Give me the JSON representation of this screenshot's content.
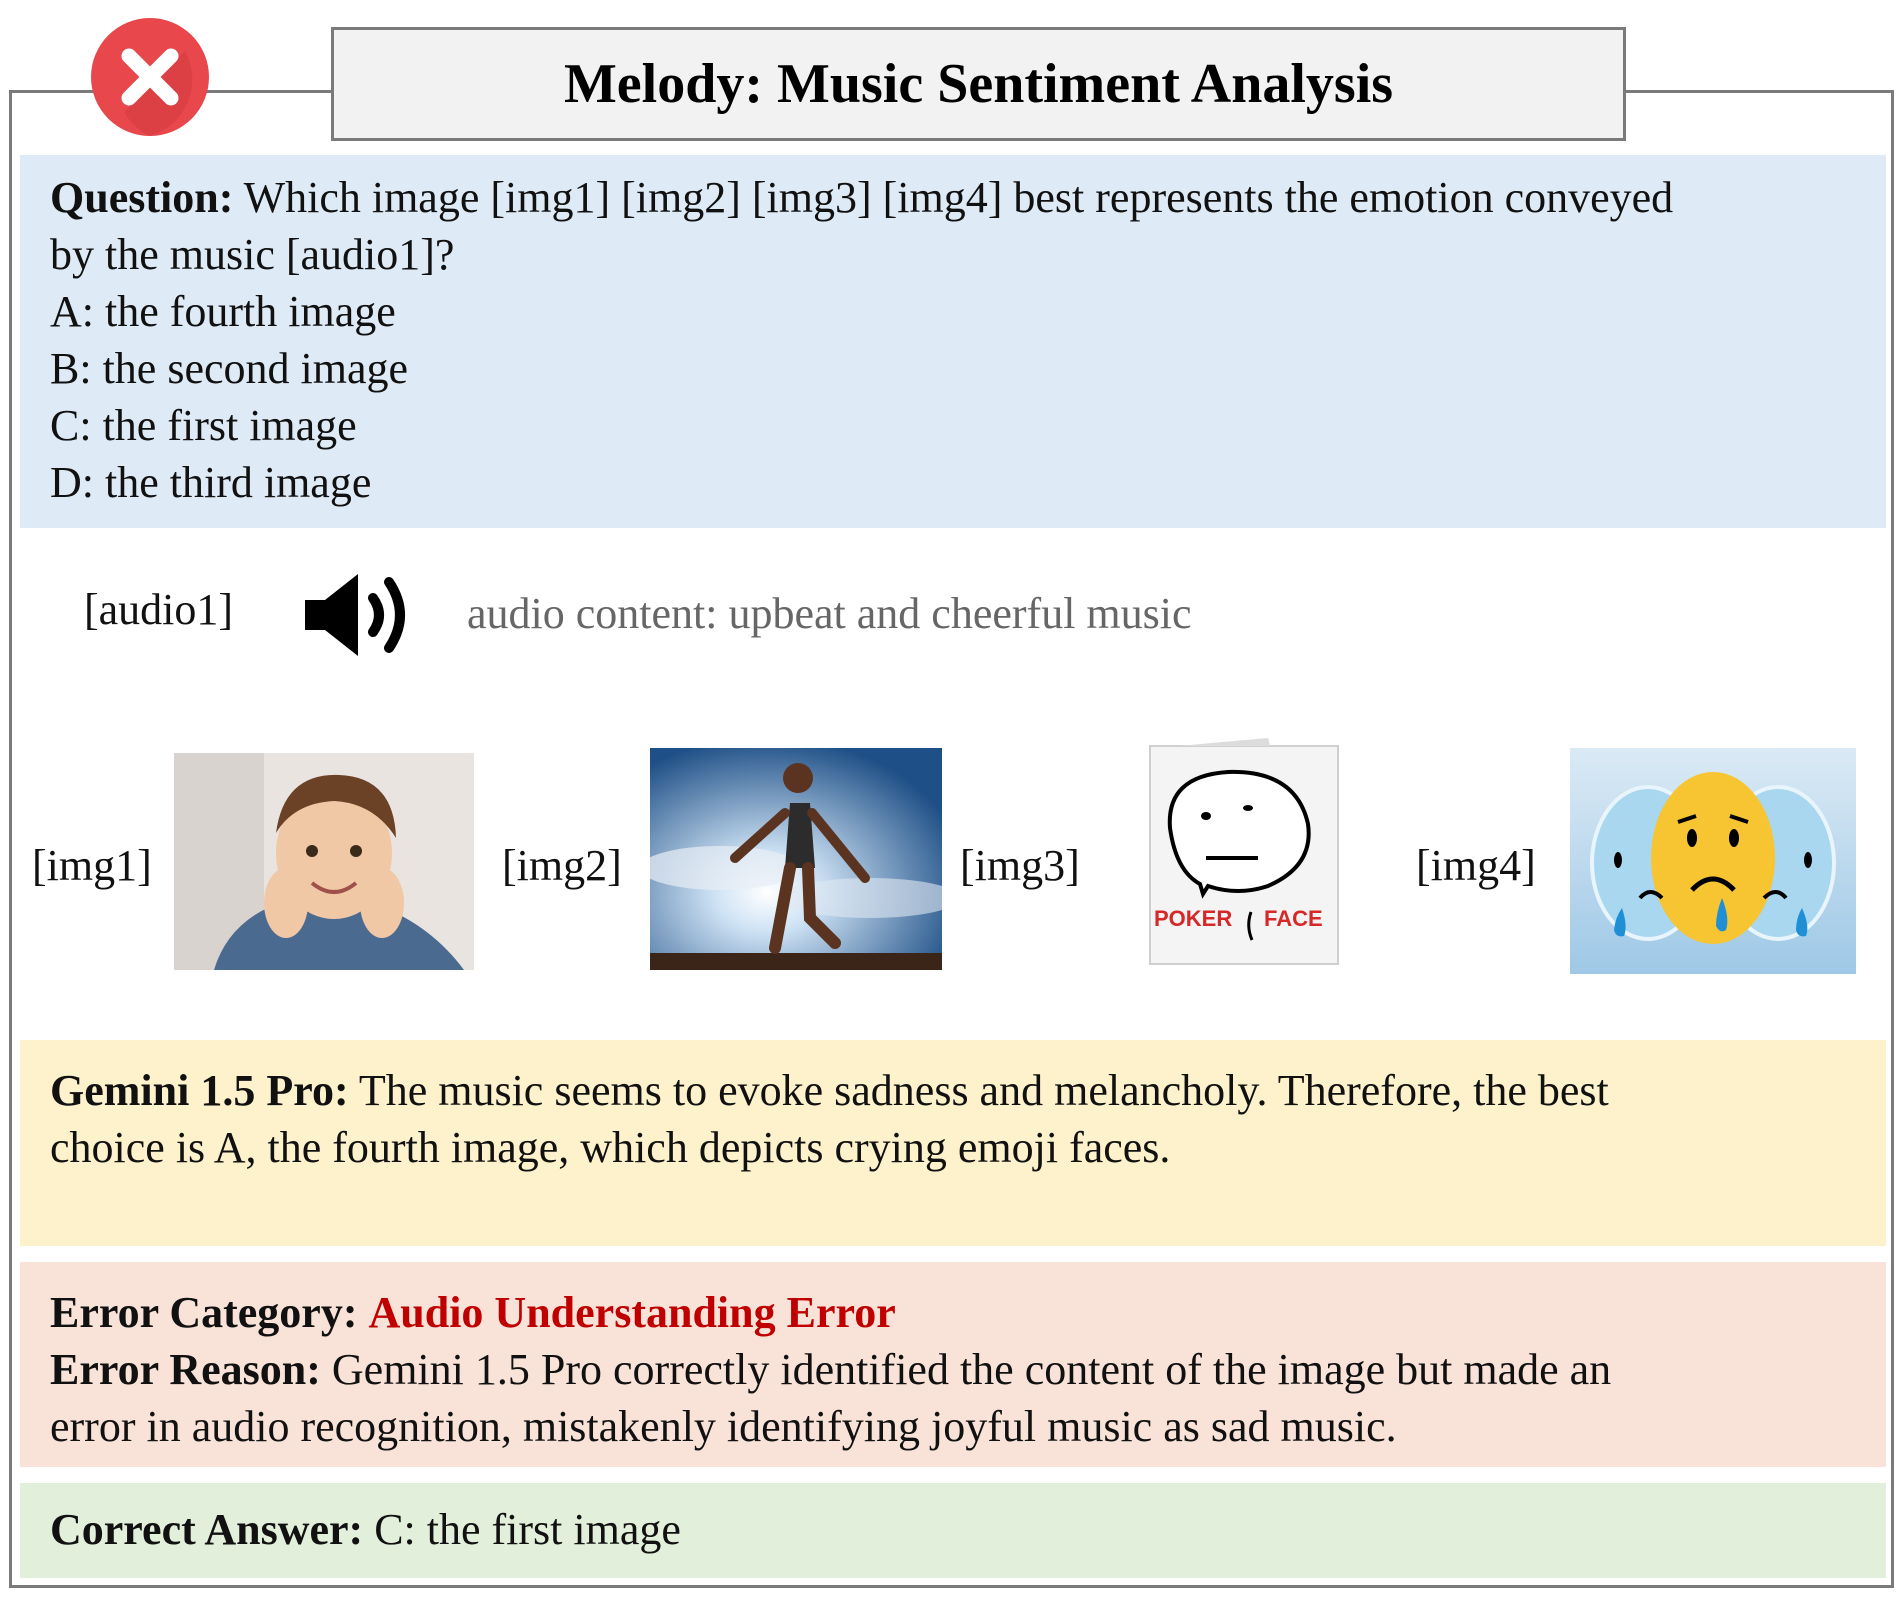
{
  "title": "Melody: Music Sentiment Analysis",
  "question": {
    "label": "Question:",
    "text_line1": "Which image [img1] [img2] [img3] [img4] best represents the emotion conveyed",
    "text_line2": "by the music [audio1]?",
    "options": [
      "A: the fourth image",
      "B: the second image",
      "C: the first image",
      "D: the third image"
    ]
  },
  "audio": {
    "label": "[audio1]",
    "description": "audio content: upbeat and cheerful music",
    "icon": "speaker-icon"
  },
  "images": [
    {
      "label": "[img1]",
      "content": "smiling-boy-photo"
    },
    {
      "label": "[img2]",
      "content": "jumping-athlete-photo"
    },
    {
      "label": "[img3]",
      "content": "poker-face-meme",
      "caption_left": "POKER",
      "caption_right": "FACE"
    },
    {
      "label": "[img4]",
      "content": "crying-emoji-faces"
    }
  ],
  "model_response": {
    "label": "Gemini 1.5 Pro:",
    "text_line1": "The music seems to evoke sadness and melancholy.  Therefore, the best",
    "text_line2": "choice is A, the fourth image, which depicts crying emoji faces."
  },
  "error": {
    "category_label": "Error Category:",
    "category_value": "Audio Understanding Error",
    "reason_label": "Error Reason:",
    "reason_line1": "Gemini 1.5 Pro correctly identified the content of the image but made an",
    "reason_line2": "error in audio recognition, mistakenly identifying joyful music as sad music."
  },
  "correct_answer": {
    "label": "Correct Answer:",
    "value": "C: the first image"
  },
  "colors": {
    "question_bg": "#deeaf6",
    "response_bg": "#fdf2cc",
    "error_bg": "#f9e3d8",
    "correct_bg": "#e2efda",
    "error_text": "#c00000",
    "badge_red": "#e8474c"
  }
}
